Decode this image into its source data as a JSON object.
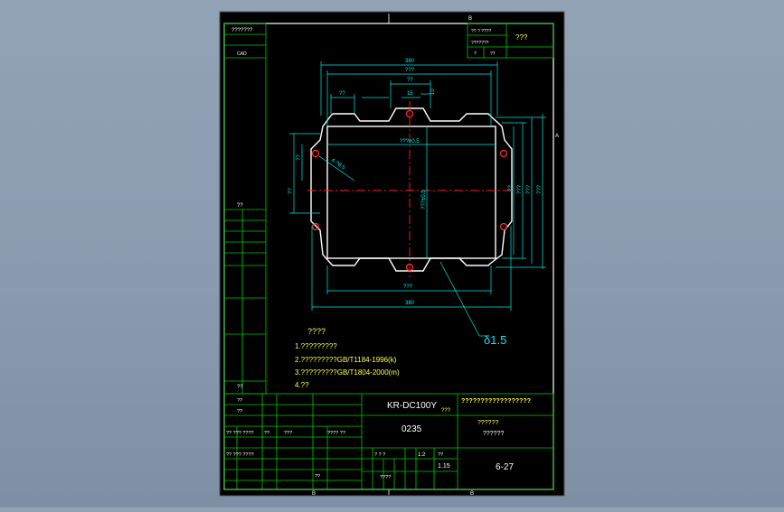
{
  "colors": {
    "background": "#8a9ab0",
    "sheet": "#000000",
    "frame": "#ffffff",
    "table_lines": "#00c800",
    "part_outline": "#ffffff",
    "dimensions": "#00ffff",
    "center_lines": "#ff2020",
    "title_text": "#ffff40"
  },
  "left_strip": {
    "top_label": "???????",
    "cad_label": "CAD",
    "sign_label": "??",
    "bottom_label": "??"
  },
  "top_right_box": {
    "row1": "?? ? ????",
    "row2": "???????",
    "row3a": "?",
    "row3b": "??",
    "stamp": "???"
  },
  "border_marks": {
    "top": "B",
    "right": "A",
    "bottom_left": "B",
    "bottom_right": "B"
  },
  "dimensions": {
    "overall_top": "380",
    "inner_top": "???",
    "left_small": "??",
    "center_top": "??",
    "center_small": "15",
    "right_small": "10",
    "inner_width": "???±0.5",
    "inner_height": "???±0.5",
    "hole_label": "4-?8.5",
    "left_v1": "??",
    "left_v2": "??",
    "right_v1": "??",
    "right_v2": "???",
    "right_v3": "???",
    "right_v4": "???",
    "bottom_inner": "???",
    "bottom_overall": "380",
    "thickness": "δ1.5"
  },
  "notes": {
    "title": "????",
    "line1": "1.?????????",
    "line2": "2.?????????GB/T1184-1996(k)",
    "line3": "3.?????????GB/T1804-2000(m)",
    "line4": "4.??"
  },
  "title_block": {
    "model": "KR-DC100Y",
    "company_title": "??????????????????",
    "company_suffix": "???",
    "part_no": "0235",
    "part_name_1": "??????",
    "part_name_2": "??????",
    "material_label": "????",
    "weight": "1.15",
    "scale": "1:2",
    "sheet": "6-27",
    "rev_labels": [
      "??",
      "??",
      "?? ??? ????",
      "?? ??? ????"
    ],
    "small_cells": [
      "??",
      "???",
      "???? ??",
      "??",
      "? ? ?",
      "??"
    ]
  }
}
